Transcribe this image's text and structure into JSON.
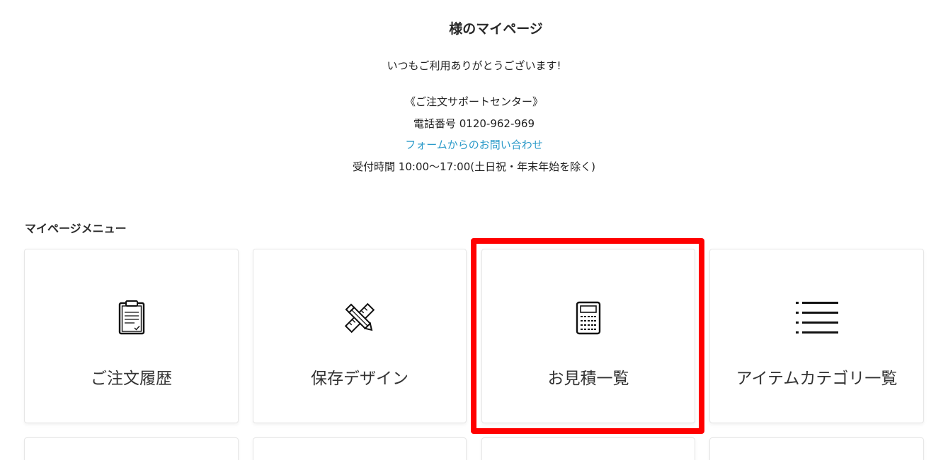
{
  "welcome": {
    "title": "様のマイページ",
    "message": "いつもご利用ありがとうございます!",
    "support_name": "《ご注文サポートセンター》",
    "phone": "電話番号 0120-962-969",
    "contact_link": "フォームからのお問い合わせ",
    "hours": "受付時間 10:00〜17:00(土日祝・年末年始を除く)"
  },
  "menu": {
    "heading": "マイページメニュー",
    "tiles": [
      {
        "label": "ご注文履歴",
        "icon": "clipboard-icon"
      },
      {
        "label": "保存デザイン",
        "icon": "pencil-ruler-icon"
      },
      {
        "label": "お見積一覧",
        "icon": "calculator-icon"
      },
      {
        "label": "アイテムカテゴリ一覧",
        "icon": "list-icon"
      }
    ]
  },
  "colors": {
    "link": "#2b9ac9",
    "highlight": "#ff0000",
    "tile_border": "#e6e6e6"
  }
}
